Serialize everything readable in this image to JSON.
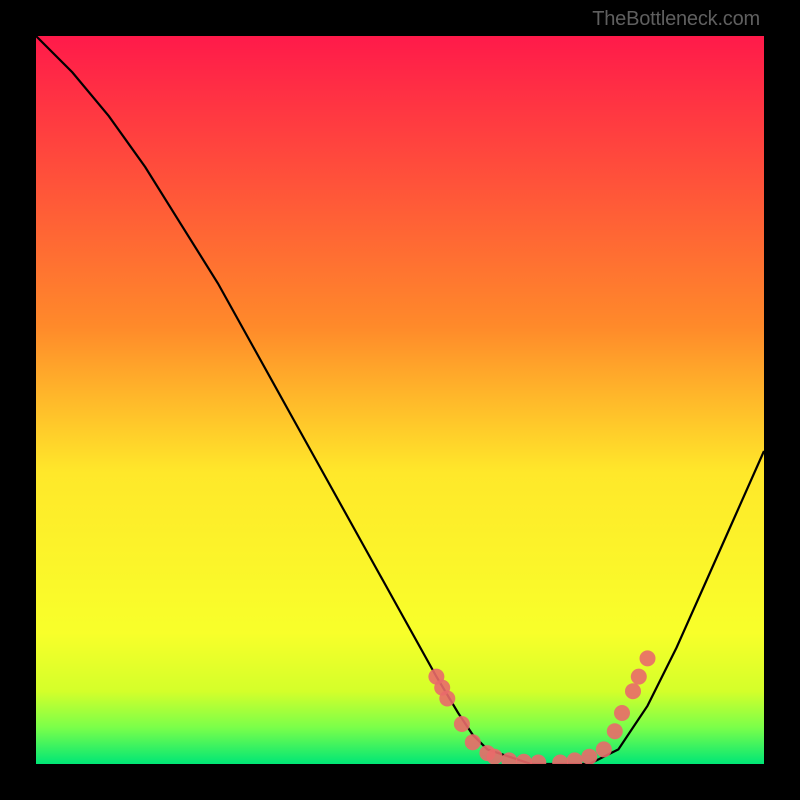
{
  "attribution": "TheBottleneck.com",
  "chart_data": {
    "type": "line",
    "title": "",
    "xlabel": "",
    "ylabel": "",
    "xlim": [
      0,
      100
    ],
    "ylim": [
      0,
      100
    ],
    "gradient_stops": [
      {
        "offset": 0,
        "color": "#ff1a4a"
      },
      {
        "offset": 40,
        "color": "#ff8a2a"
      },
      {
        "offset": 60,
        "color": "#ffe82a"
      },
      {
        "offset": 82,
        "color": "#f8ff2a"
      },
      {
        "offset": 90,
        "color": "#d4ff2a"
      },
      {
        "offset": 95,
        "color": "#7aff4a"
      },
      {
        "offset": 100,
        "color": "#00e676"
      }
    ],
    "series": [
      {
        "name": "bottleneck-curve",
        "color": "#000000",
        "x": [
          0,
          5,
          10,
          15,
          20,
          25,
          30,
          35,
          40,
          45,
          50,
          55,
          58,
          60,
          62,
          65,
          68,
          72,
          76,
          80,
          84,
          88,
          92,
          96,
          100
        ],
        "y": [
          100,
          95,
          89,
          82,
          74,
          66,
          57,
          48,
          39,
          30,
          21,
          12,
          7,
          4,
          2,
          1,
          0,
          0,
          0,
          2,
          8,
          16,
          25,
          34,
          43
        ]
      }
    ],
    "markers": {
      "name": "highlighted-points",
      "color": "#e96a6a",
      "radius": 8,
      "points": [
        {
          "x": 55.0,
          "y": 12.0
        },
        {
          "x": 55.8,
          "y": 10.5
        },
        {
          "x": 56.5,
          "y": 9.0
        },
        {
          "x": 58.5,
          "y": 5.5
        },
        {
          "x": 60.0,
          "y": 3.0
        },
        {
          "x": 62.0,
          "y": 1.5
        },
        {
          "x": 63.0,
          "y": 1.0
        },
        {
          "x": 65.0,
          "y": 0.5
        },
        {
          "x": 67.0,
          "y": 0.3
        },
        {
          "x": 69.0,
          "y": 0.2
        },
        {
          "x": 72.0,
          "y": 0.2
        },
        {
          "x": 74.0,
          "y": 0.5
        },
        {
          "x": 76.0,
          "y": 1.0
        },
        {
          "x": 78.0,
          "y": 2.0
        },
        {
          "x": 79.5,
          "y": 4.5
        },
        {
          "x": 80.5,
          "y": 7.0
        },
        {
          "x": 82.0,
          "y": 10.0
        },
        {
          "x": 82.8,
          "y": 12.0
        },
        {
          "x": 84.0,
          "y": 14.5
        }
      ]
    }
  }
}
